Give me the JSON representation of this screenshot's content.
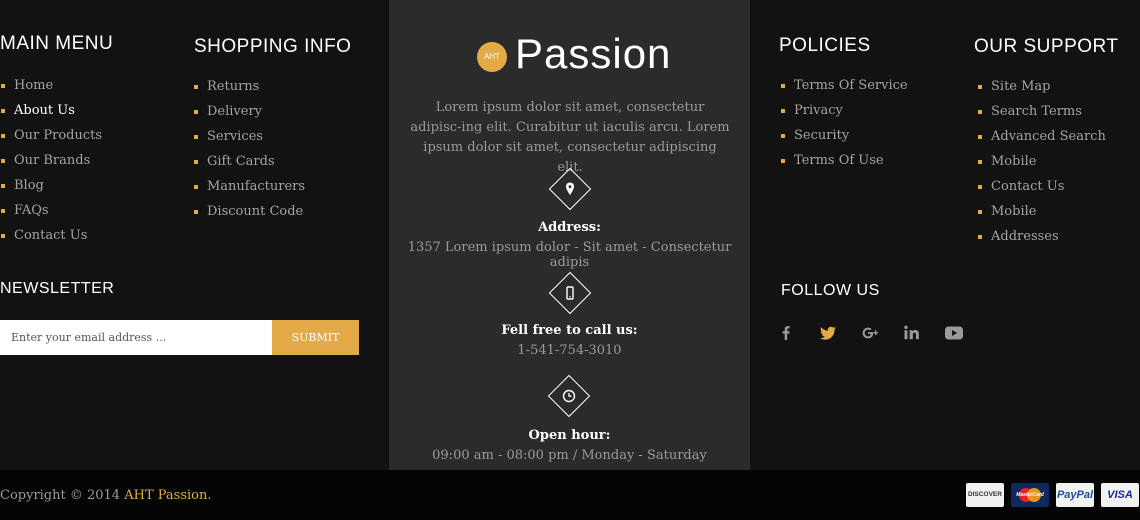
{
  "main_menu": {
    "title": "MAIN MENU",
    "items": [
      "Home",
      "About Us",
      "Our Products",
      "Our Brands",
      "Blog",
      "FAQs",
      "Contact Us"
    ]
  },
  "shopping_info": {
    "title": "SHOPPING INFO",
    "items": [
      "Returns",
      "Delivery",
      "Services",
      "Gift Cards",
      "Manufacturers",
      "Discount Code"
    ]
  },
  "newsletter": {
    "title": "NEWSLETTER",
    "placeholder": "Enter your email address ...",
    "submit_label": "SUBMIT"
  },
  "center": {
    "logo_badge": "AHT",
    "logo_text": "Passion",
    "description": "Lorem ipsum dolor sit amet, consectetur adipisc-ing elit. Curabitur ut iaculis arcu. Lorem ipsum dolor sit amet, consectetur adipiscing elit.",
    "address_label": "Address:",
    "address_value": "1357 Lorem ipsum dolor - Sit amet - Consectetur adipis",
    "phone_label": "Fell free to call us:",
    "phone_value": "1-541-754-3010",
    "hours_label": "Open hour:",
    "hours_value": "09:00 am - 08:00 pm / Monday - Saturday"
  },
  "policies": {
    "title": "POLICIES",
    "items": [
      "Terms Of Service",
      "Privacy",
      "Security",
      "Terms Of Use"
    ]
  },
  "our_support": {
    "title": "OUR SUPPORT",
    "items": [
      "Site Map",
      "Search Terms",
      "Advanced Search",
      "Mobile",
      "Contact Us",
      "Mobile",
      "Addresses"
    ]
  },
  "follow_us": {
    "title": "FOLLOW US",
    "icons": [
      "facebook-icon",
      "twitter-icon",
      "google-plus-icon",
      "linkedin-icon",
      "youtube-icon"
    ]
  },
  "footer": {
    "copyright_prefix": "Copyright © 2014",
    "brand": "AHT Passion",
    "suffix": ".",
    "payments": [
      "DISCOVER",
      "MasterCard",
      "PayPal",
      "VISA"
    ]
  },
  "colors": {
    "accent": "#e5aa48",
    "background": "#121212",
    "center_panel": "#2b2b2b",
    "bottom_bar": "#050505"
  }
}
